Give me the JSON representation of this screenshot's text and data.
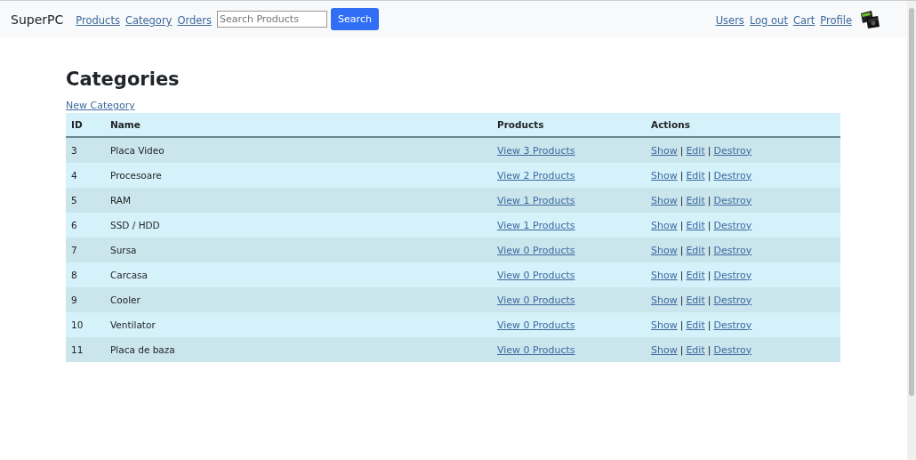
{
  "navbar": {
    "brand": "SuperPC",
    "left_links": [
      "Products",
      "Category",
      "Orders"
    ],
    "search": {
      "placeholder": "Search Products",
      "button": "Search"
    },
    "right_links": [
      "Users",
      "Log out",
      "Cart",
      "Profile"
    ],
    "avatar": {
      "kind": "picture"
    }
  },
  "page": {
    "title": "Categories",
    "new_link": "New Category"
  },
  "table": {
    "columns": [
      "ID",
      "Name",
      "Products",
      "Actions"
    ],
    "rows": [
      {
        "id": "3",
        "name": "Placa Video",
        "products": "View 3 Products",
        "actions": [
          {
            "kind": "link",
            "text": "Show"
          },
          {
            "kind": "separator",
            "text": "|"
          },
          {
            "kind": "link",
            "text": "Edit"
          },
          {
            "kind": "separator",
            "text": "|"
          },
          {
            "kind": "link",
            "text": "Destroy"
          }
        ]
      },
      {
        "id": "4",
        "name": "Procesoare",
        "products": "View 2 Products",
        "actions": [
          {
            "kind": "link",
            "text": "Show"
          },
          {
            "kind": "separator",
            "text": "|"
          },
          {
            "kind": "link",
            "text": "Edit"
          },
          {
            "kind": "separator",
            "text": "|"
          },
          {
            "kind": "link",
            "text": "Destroy"
          }
        ]
      },
      {
        "id": "5",
        "name": "RAM",
        "products": "View 1 Products",
        "actions": [
          {
            "kind": "link",
            "text": "Show"
          },
          {
            "kind": "separator",
            "text": "|"
          },
          {
            "kind": "link",
            "text": "Edit"
          },
          {
            "kind": "separator",
            "text": "|"
          },
          {
            "kind": "link",
            "text": "Destroy"
          }
        ]
      },
      {
        "id": "6",
        "name": "SSD / HDD",
        "products": "View 1 Products",
        "actions": [
          {
            "kind": "link",
            "text": "Show"
          },
          {
            "kind": "separator",
            "text": "|"
          },
          {
            "kind": "link",
            "text": "Edit"
          },
          {
            "kind": "separator",
            "text": "|"
          },
          {
            "kind": "link",
            "text": "Destroy"
          }
        ]
      },
      {
        "id": "7",
        "name": "Sursa",
        "products": "View 0 Products",
        "actions": [
          {
            "kind": "link",
            "text": "Show"
          },
          {
            "kind": "separator",
            "text": "|"
          },
          {
            "kind": "link",
            "text": "Edit"
          },
          {
            "kind": "separator",
            "text": "|"
          },
          {
            "kind": "link",
            "text": "Destroy"
          }
        ]
      },
      {
        "id": "8",
        "name": "Carcasa",
        "products": "View 0 Products",
        "actions": [
          {
            "kind": "link",
            "text": "Show"
          },
          {
            "kind": "separator",
            "text": "|"
          },
          {
            "kind": "link",
            "text": "Edit"
          },
          {
            "kind": "separator",
            "text": "|"
          },
          {
            "kind": "link",
            "text": "Destroy"
          }
        ]
      },
      {
        "id": "9",
        "name": "Cooler",
        "products": "View 0 Products",
        "actions": [
          {
            "kind": "link",
            "text": "Show"
          },
          {
            "kind": "separator",
            "text": "|"
          },
          {
            "kind": "link",
            "text": "Edit"
          },
          {
            "kind": "separator",
            "text": "|"
          },
          {
            "kind": "link",
            "text": "Destroy"
          }
        ]
      },
      {
        "id": "10",
        "name": "Ventilator",
        "products": "View 0 Products",
        "actions": [
          {
            "kind": "link",
            "text": "Show"
          },
          {
            "kind": "separator",
            "text": "|"
          },
          {
            "kind": "link",
            "text": "Edit"
          },
          {
            "kind": "separator",
            "text": "|"
          },
          {
            "kind": "link",
            "text": "Destroy"
          }
        ]
      },
      {
        "id": "11",
        "name": "Placa de baza",
        "products": "View 0 Products",
        "actions": [
          {
            "kind": "link",
            "text": "Show"
          },
          {
            "kind": "separator",
            "text": "|"
          },
          {
            "kind": "link",
            "text": "Edit"
          },
          {
            "kind": "separator",
            "text": "|"
          },
          {
            "kind": "link",
            "text": "Destroy"
          }
        ]
      }
    ]
  }
}
